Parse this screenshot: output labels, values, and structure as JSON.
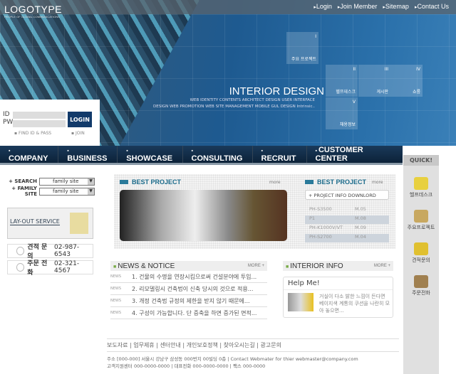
{
  "header": {
    "logo": "LOGOTYPE",
    "logo_tagline": "PEOPLE OF GLOBAL COMMUNICATIONS",
    "top_links": [
      "Login",
      "Join Member",
      "Sitemap",
      "Contact Us"
    ],
    "title": "INTERIOR DESIGN",
    "subtitle_lines": [
      "WEB IDENTITY CONTENTS ARCHITECT DESIGN USER INTERFACE",
      "DESIGN WEB PROMOTION WEB SITE MANAGEMENT MOBILE GUL DESIGN Intrinsic.."
    ],
    "tiles": [
      {
        "num": "I",
        "label": "주요 프로젝트"
      },
      {
        "num": "II",
        "label": "헬프데스크"
      },
      {
        "num": "III",
        "label": "게시판"
      },
      {
        "num": "IV",
        "label": "쇼룸"
      },
      {
        "num": "V",
        "label": "채용정보"
      }
    ]
  },
  "login": {
    "id_label": "ID",
    "pw_label": "PW",
    "button": "LOGIN",
    "find": "FIND ID & PASS",
    "join": "JOIN"
  },
  "nav": [
    "COMPANY",
    "BUSINESS",
    "SHOWCASE",
    "CONSULTING",
    "RECRUIT",
    "CUSTOMER CENTER"
  ],
  "quick": {
    "title": "QUICK!",
    "items": [
      "헬프데스크",
      "주요프로젝트",
      "견적문의",
      "주문전화"
    ]
  },
  "left": {
    "search_label": "+ SEARCH",
    "search_value": "family site",
    "family_label": "+ FAMILY SITE",
    "family_value": "family site",
    "layout_service": "LAY-OUT SERVICE",
    "phones": [
      {
        "label": "견적 문의",
        "number": "02-987-6543"
      },
      {
        "label": "주문 전화",
        "number": "02-321-4567"
      }
    ]
  },
  "best_project": {
    "title": "BEST PROJECT",
    "more": "more",
    "right_title": "BEST PROJECT",
    "download": "+ PROJECT INFO DOWNLORD",
    "rows": [
      [
        "PH-S3500",
        "M.05"
      ],
      [
        "P1",
        "M.08"
      ],
      [
        "PH-K1000V/VT",
        "M.09"
      ],
      [
        "PH-S2700",
        "M.04"
      ]
    ]
  },
  "news": {
    "title": "NEWS & NOTICE",
    "more": "MORE +",
    "tag": "NEWS",
    "items": [
      "1. 건물의 수명을 연장시킴으로써 건설분야에 투입...",
      "2. 리모델링시 건축법이 신축 당시의 것으로 적용...",
      "3. 개정 건축법 규정의 제한을 받지 않기 때문에...",
      "4. 구성이 가능합니다. 단 증축을 하면 증가된 면적..."
    ]
  },
  "interior": {
    "title": "INTERIOR INFO",
    "more": "MORE +",
    "help": "Help Me!",
    "text": "거실이 다소 밝한 느낌이 든다면 베이지색 계통의 쿠션을 나란히 모아 놓으면..."
  },
  "footer": {
    "links": "보도자료 | 업무제휴 | 센터안내 | 개인보호정책 | 찾아오시는길 | 광고문의",
    "address1": "주소 [000-000] 서울시 강남구 삼성동 000번지 00빌딩 0층 | Contact Webmater for thier webmaster@company.com",
    "address2": "고객지원센터 000-0000-0000 | 대표전화 000-0000-0000 | 팩스 000-0000"
  }
}
